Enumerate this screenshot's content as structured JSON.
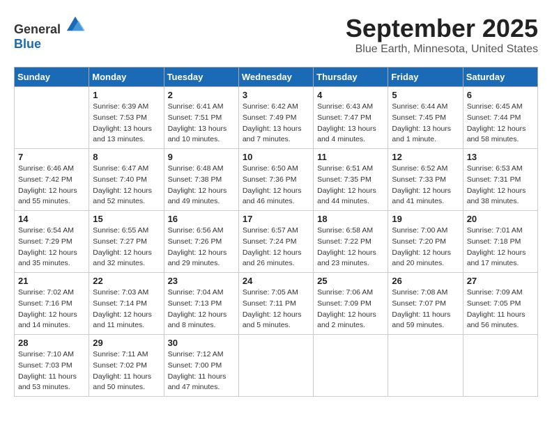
{
  "header": {
    "logo_general": "General",
    "logo_blue": "Blue",
    "month": "September 2025",
    "location": "Blue Earth, Minnesota, United States"
  },
  "days_of_week": [
    "Sunday",
    "Monday",
    "Tuesday",
    "Wednesday",
    "Thursday",
    "Friday",
    "Saturday"
  ],
  "weeks": [
    [
      {
        "day": "",
        "sunrise": "",
        "sunset": "",
        "daylight": ""
      },
      {
        "day": "1",
        "sunrise": "Sunrise: 6:39 AM",
        "sunset": "Sunset: 7:53 PM",
        "daylight": "Daylight: 13 hours and 13 minutes."
      },
      {
        "day": "2",
        "sunrise": "Sunrise: 6:41 AM",
        "sunset": "Sunset: 7:51 PM",
        "daylight": "Daylight: 13 hours and 10 minutes."
      },
      {
        "day": "3",
        "sunrise": "Sunrise: 6:42 AM",
        "sunset": "Sunset: 7:49 PM",
        "daylight": "Daylight: 13 hours and 7 minutes."
      },
      {
        "day": "4",
        "sunrise": "Sunrise: 6:43 AM",
        "sunset": "Sunset: 7:47 PM",
        "daylight": "Daylight: 13 hours and 4 minutes."
      },
      {
        "day": "5",
        "sunrise": "Sunrise: 6:44 AM",
        "sunset": "Sunset: 7:45 PM",
        "daylight": "Daylight: 13 hours and 1 minute."
      },
      {
        "day": "6",
        "sunrise": "Sunrise: 6:45 AM",
        "sunset": "Sunset: 7:44 PM",
        "daylight": "Daylight: 12 hours and 58 minutes."
      }
    ],
    [
      {
        "day": "7",
        "sunrise": "Sunrise: 6:46 AM",
        "sunset": "Sunset: 7:42 PM",
        "daylight": "Daylight: 12 hours and 55 minutes."
      },
      {
        "day": "8",
        "sunrise": "Sunrise: 6:47 AM",
        "sunset": "Sunset: 7:40 PM",
        "daylight": "Daylight: 12 hours and 52 minutes."
      },
      {
        "day": "9",
        "sunrise": "Sunrise: 6:48 AM",
        "sunset": "Sunset: 7:38 PM",
        "daylight": "Daylight: 12 hours and 49 minutes."
      },
      {
        "day": "10",
        "sunrise": "Sunrise: 6:50 AM",
        "sunset": "Sunset: 7:36 PM",
        "daylight": "Daylight: 12 hours and 46 minutes."
      },
      {
        "day": "11",
        "sunrise": "Sunrise: 6:51 AM",
        "sunset": "Sunset: 7:35 PM",
        "daylight": "Daylight: 12 hours and 44 minutes."
      },
      {
        "day": "12",
        "sunrise": "Sunrise: 6:52 AM",
        "sunset": "Sunset: 7:33 PM",
        "daylight": "Daylight: 12 hours and 41 minutes."
      },
      {
        "day": "13",
        "sunrise": "Sunrise: 6:53 AM",
        "sunset": "Sunset: 7:31 PM",
        "daylight": "Daylight: 12 hours and 38 minutes."
      }
    ],
    [
      {
        "day": "14",
        "sunrise": "Sunrise: 6:54 AM",
        "sunset": "Sunset: 7:29 PM",
        "daylight": "Daylight: 12 hours and 35 minutes."
      },
      {
        "day": "15",
        "sunrise": "Sunrise: 6:55 AM",
        "sunset": "Sunset: 7:27 PM",
        "daylight": "Daylight: 12 hours and 32 minutes."
      },
      {
        "day": "16",
        "sunrise": "Sunrise: 6:56 AM",
        "sunset": "Sunset: 7:26 PM",
        "daylight": "Daylight: 12 hours and 29 minutes."
      },
      {
        "day": "17",
        "sunrise": "Sunrise: 6:57 AM",
        "sunset": "Sunset: 7:24 PM",
        "daylight": "Daylight: 12 hours and 26 minutes."
      },
      {
        "day": "18",
        "sunrise": "Sunrise: 6:58 AM",
        "sunset": "Sunset: 7:22 PM",
        "daylight": "Daylight: 12 hours and 23 minutes."
      },
      {
        "day": "19",
        "sunrise": "Sunrise: 7:00 AM",
        "sunset": "Sunset: 7:20 PM",
        "daylight": "Daylight: 12 hours and 20 minutes."
      },
      {
        "day": "20",
        "sunrise": "Sunrise: 7:01 AM",
        "sunset": "Sunset: 7:18 PM",
        "daylight": "Daylight: 12 hours and 17 minutes."
      }
    ],
    [
      {
        "day": "21",
        "sunrise": "Sunrise: 7:02 AM",
        "sunset": "Sunset: 7:16 PM",
        "daylight": "Daylight: 12 hours and 14 minutes."
      },
      {
        "day": "22",
        "sunrise": "Sunrise: 7:03 AM",
        "sunset": "Sunset: 7:14 PM",
        "daylight": "Daylight: 12 hours and 11 minutes."
      },
      {
        "day": "23",
        "sunrise": "Sunrise: 7:04 AM",
        "sunset": "Sunset: 7:13 PM",
        "daylight": "Daylight: 12 hours and 8 minutes."
      },
      {
        "day": "24",
        "sunrise": "Sunrise: 7:05 AM",
        "sunset": "Sunset: 7:11 PM",
        "daylight": "Daylight: 12 hours and 5 minutes."
      },
      {
        "day": "25",
        "sunrise": "Sunrise: 7:06 AM",
        "sunset": "Sunset: 7:09 PM",
        "daylight": "Daylight: 12 hours and 2 minutes."
      },
      {
        "day": "26",
        "sunrise": "Sunrise: 7:08 AM",
        "sunset": "Sunset: 7:07 PM",
        "daylight": "Daylight: 11 hours and 59 minutes."
      },
      {
        "day": "27",
        "sunrise": "Sunrise: 7:09 AM",
        "sunset": "Sunset: 7:05 PM",
        "daylight": "Daylight: 11 hours and 56 minutes."
      }
    ],
    [
      {
        "day": "28",
        "sunrise": "Sunrise: 7:10 AM",
        "sunset": "Sunset: 7:03 PM",
        "daylight": "Daylight: 11 hours and 53 minutes."
      },
      {
        "day": "29",
        "sunrise": "Sunrise: 7:11 AM",
        "sunset": "Sunset: 7:02 PM",
        "daylight": "Daylight: 11 hours and 50 minutes."
      },
      {
        "day": "30",
        "sunrise": "Sunrise: 7:12 AM",
        "sunset": "Sunset: 7:00 PM",
        "daylight": "Daylight: 11 hours and 47 minutes."
      },
      {
        "day": "",
        "sunrise": "",
        "sunset": "",
        "daylight": ""
      },
      {
        "day": "",
        "sunrise": "",
        "sunset": "",
        "daylight": ""
      },
      {
        "day": "",
        "sunrise": "",
        "sunset": "",
        "daylight": ""
      },
      {
        "day": "",
        "sunrise": "",
        "sunset": "",
        "daylight": ""
      }
    ]
  ]
}
